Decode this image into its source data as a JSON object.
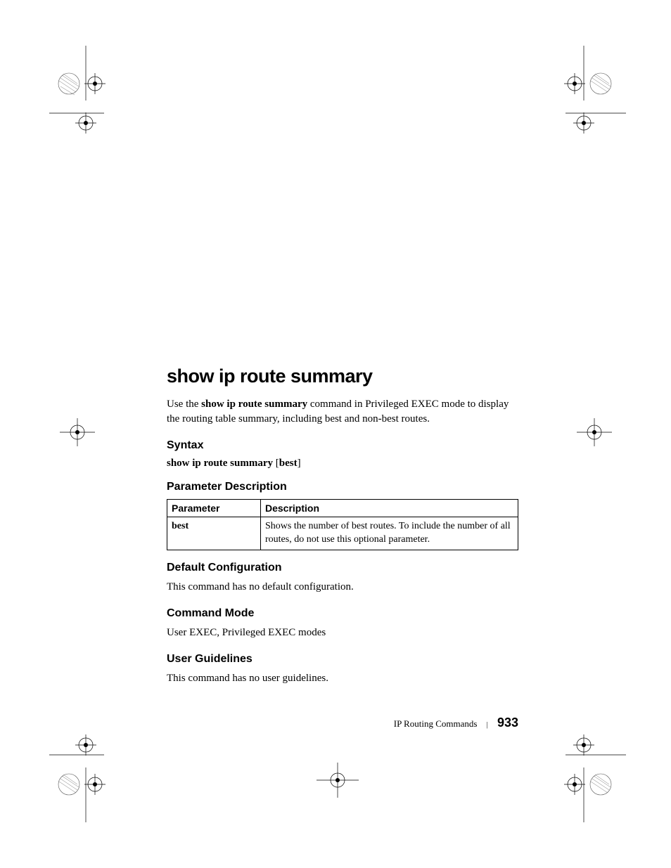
{
  "title": "show ip route summary",
  "intro_pre": "Use the ",
  "intro_cmd": "show ip route summary",
  "intro_post": " command in Privileged EXEC mode to display the routing table summary, including best and non-best routes.",
  "syntax_heading": "Syntax",
  "syntax_cmd": "show ip route summary",
  "syntax_opt": " [",
  "syntax_opt_bold": "best",
  "syntax_opt_close": "]",
  "param_heading": "Parameter Description",
  "table": {
    "header_param": "Parameter",
    "header_desc": "Description",
    "row1_param": "best",
    "row1_desc": "Shows the number of best routes. To include the number of all routes, do not use this optional parameter."
  },
  "default_heading": "Default Configuration",
  "default_text": "This command has no default configuration.",
  "mode_heading": "Command Mode",
  "mode_text": "User EXEC, Privileged EXEC modes",
  "guidelines_heading": "User Guidelines",
  "guidelines_text": "This command has no user guidelines.",
  "footer": {
    "section": "IP Routing Commands",
    "page": "933"
  }
}
